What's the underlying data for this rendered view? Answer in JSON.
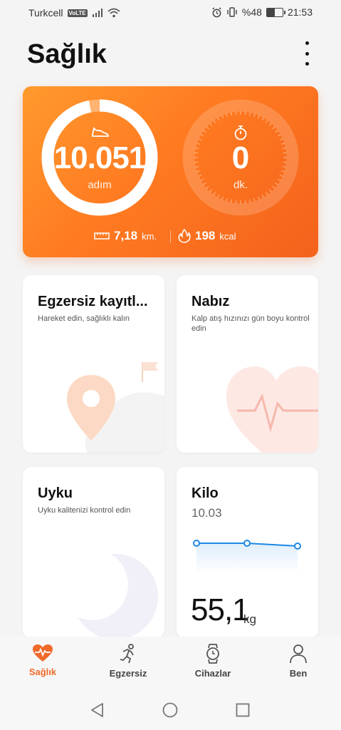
{
  "status": {
    "carrier": "Turkcell",
    "volte": "VoLTE",
    "battery": "%48",
    "time": "21:53"
  },
  "header": {
    "title": "Sağlık"
  },
  "hero": {
    "steps_value": "10.051",
    "steps_unit": "adım",
    "minutes_value": "0",
    "minutes_unit": "dk.",
    "steps_progress": 0.97,
    "distance_value": "7,18",
    "distance_unit": "km.",
    "calories_value": "198",
    "calories_unit": "kcal"
  },
  "cards": {
    "exercise": {
      "title": "Egzersiz kayıtl...",
      "subtitle": "Hareket edin, sağlıklı kalın"
    },
    "heart": {
      "title": "Nabız",
      "subtitle": "Kalp atış hızınızı gün boyu kontrol edin"
    },
    "sleep": {
      "title": "Uyku",
      "subtitle": "Uyku kalitenizi kontrol edin"
    },
    "weight": {
      "title": "Kilo",
      "date": "10.03",
      "value": "55,1",
      "unit": "kg"
    }
  },
  "nav": [
    {
      "label": "Sağlık"
    },
    {
      "label": "Egzersiz"
    },
    {
      "label": "Cihazlar"
    },
    {
      "label": "Ben"
    }
  ],
  "colors": {
    "accent": "#f06a2b",
    "weight_line": "#1e88e5"
  }
}
